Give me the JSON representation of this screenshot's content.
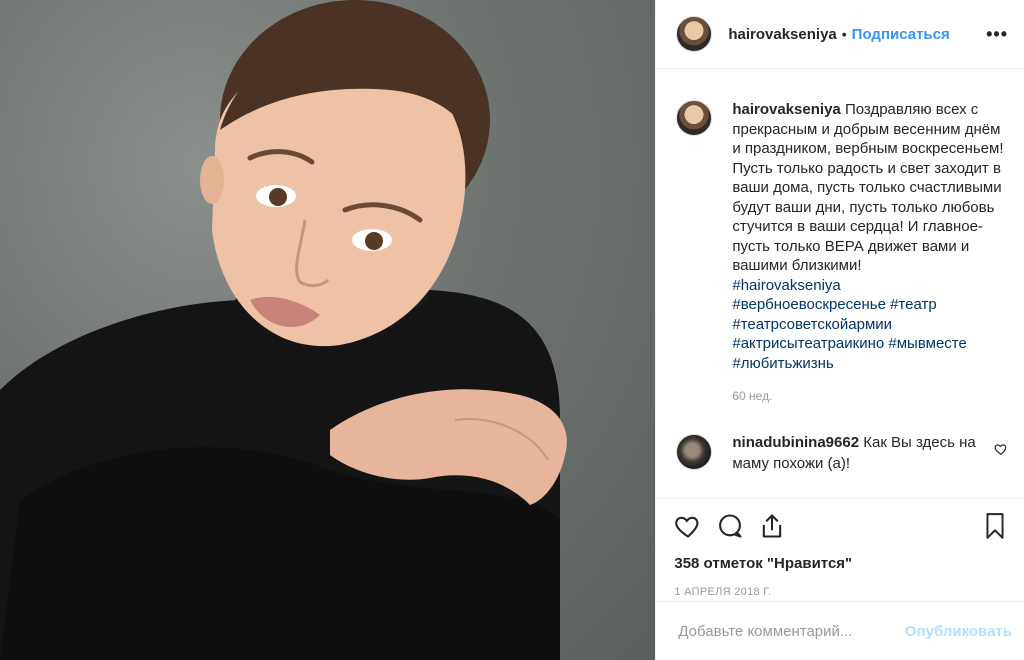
{
  "header": {
    "username": "hairovakseniya",
    "separator": "•",
    "follow_label": "Подписаться",
    "more_label": "•••"
  },
  "caption": {
    "username": "hairovakseniya",
    "text": "Поздравляю всех с прекрасным и добрым весенним днём и праздником, вербным воскресеньем! Пусть только радость и свет заходит в ваши дома, пусть только счастливыми будут ваши дни, пусть только любовь стучится в ваши сердца! И главное- пусть только ВЕРА движет вами и вашими близкими!",
    "hashtags": {
      "line1": "#hairovakseniya",
      "line2a": "#вербноевоскресенье",
      "line2b": "#театр",
      "line3": "#театрсоветскойармии",
      "line4a": "#актрисытеатраикино",
      "line4b": "#мывместе",
      "line5": "#любитьжизнь"
    },
    "time_ago": "60 нед."
  },
  "comment": {
    "username": "ninadubinina9662",
    "text": "Как Вы здесь на маму похожи (а)!"
  },
  "actions": {
    "likes": "358 отметок \"Нравится\"",
    "date": "1 апреля 2018 г."
  },
  "add_comment": {
    "placeholder": "Добавьте комментарий...",
    "publish_label": "Опубликовать"
  },
  "colors": {
    "link": "#3897f0",
    "hashtag": "#003569",
    "muted": "#999999",
    "publish_disabled": "#b2dffc"
  }
}
